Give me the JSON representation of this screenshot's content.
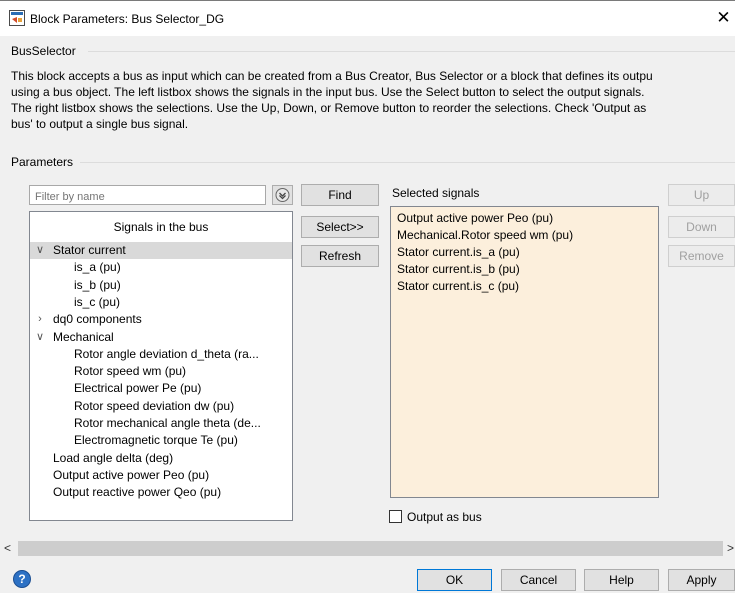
{
  "window": {
    "title": "Block Parameters: Bus Selector_DG",
    "close_glyph": "✕"
  },
  "block_section": {
    "label": "BusSelector",
    "description_lines": [
      "This block accepts a bus as input which can be created from a Bus Creator, Bus Selector or a block that defines its outpu",
      "using a bus object. The left listbox shows the signals in the input bus. Use the Select button to select the output signals.",
      "The right listbox shows the selections. Use the Up, Down, or Remove button to reorder the selections. Check 'Output as",
      "bus' to output a single bus signal."
    ]
  },
  "parameters": {
    "label": "Parameters",
    "filter": {
      "placeholder": "Filter by name",
      "value": "",
      "button_icon": "chevron-down-circle-icon"
    },
    "signals_in_bus": {
      "header": "Signals in the bus",
      "items": [
        {
          "label": "Stator current",
          "level": 0,
          "expander": "∨",
          "selected": true
        },
        {
          "label": "is_a (pu)",
          "level": 1,
          "expander": ""
        },
        {
          "label": "is_b (pu)",
          "level": 1,
          "expander": ""
        },
        {
          "label": "is_c (pu)",
          "level": 1,
          "expander": ""
        },
        {
          "label": "dq0 components",
          "level": 0,
          "expander": "›"
        },
        {
          "label": "Mechanical",
          "level": 0,
          "expander": "∨"
        },
        {
          "label": "Rotor angle deviation  d_theta (ra...",
          "level": 1,
          "expander": ""
        },
        {
          "label": "Rotor speed  wm  (pu)",
          "level": 1,
          "expander": ""
        },
        {
          "label": "Electrical power  Pe (pu)",
          "level": 1,
          "expander": ""
        },
        {
          "label": "Rotor speed deviation  dw (pu)",
          "level": 1,
          "expander": ""
        },
        {
          "label": "Rotor mechanical angle  theta (de...",
          "level": 1,
          "expander": ""
        },
        {
          "label": "Electromagnetic torque  Te (pu)",
          "level": 1,
          "expander": ""
        },
        {
          "label": "Load angle   delta  (deg)",
          "level": 0,
          "expander": ""
        },
        {
          "label": "Output active power   Peo (pu)",
          "level": 0,
          "expander": ""
        },
        {
          "label": "Output reactive power  Qeo (pu)",
          "level": 0,
          "expander": ""
        }
      ]
    },
    "middle_buttons": {
      "find": "Find",
      "select": "Select>>",
      "refresh": "Refresh"
    },
    "selected_signals": {
      "label": "Selected signals",
      "items": [
        "Output active power   Peo (pu)",
        "Mechanical.Rotor speed  wm  (pu)",
        "Stator current.is_a (pu)",
        "Stator current.is_b (pu)",
        "Stator current.is_c (pu)"
      ]
    },
    "reorder_buttons": {
      "up": "Up",
      "down": "Down",
      "remove": "Remove",
      "enabled": false
    },
    "output_as_bus": {
      "label": "Output as bus",
      "checked": false
    }
  },
  "scrollbar": {
    "left_arrow": "<",
    "right_arrow": ">"
  },
  "footer": {
    "help_glyph": "?",
    "ok": "OK",
    "cancel": "Cancel",
    "help": "Help",
    "apply": "Apply"
  },
  "colors": {
    "selected_list_bg": "#fcefdc",
    "tree_selection": "#d9d9d9",
    "help_icon": "#2d71c4",
    "primary_border": "#0078d7"
  }
}
